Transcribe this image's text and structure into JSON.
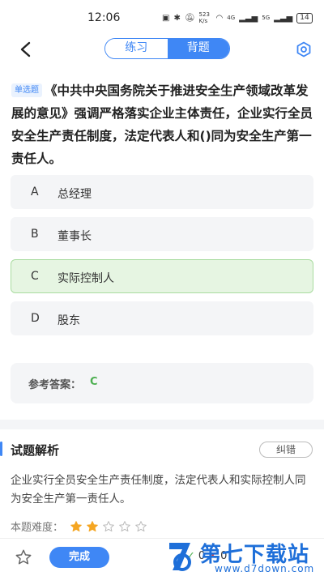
{
  "status_bar": {
    "time": "12:06",
    "network_speed": "523 K/s",
    "signal_labels": [
      "4G",
      "5G"
    ],
    "battery": "14"
  },
  "header": {
    "tabs": [
      {
        "label": "练习",
        "active": false
      },
      {
        "label": "背题",
        "active": true
      }
    ]
  },
  "question": {
    "type_badge": "单选题",
    "text": "《中共中央国务院关于推进安全生产领域改革发展的意见》强调严格落实企业主体责任，企业实行全员安全生产责任制度，法定代表人和()同为安全生产第一责任人。"
  },
  "options": [
    {
      "letter": "A",
      "text": "总经理",
      "state": "normal"
    },
    {
      "letter": "B",
      "text": "董事长",
      "state": "normal"
    },
    {
      "letter": "C",
      "text": "实际控制人",
      "state": "correct"
    },
    {
      "letter": "D",
      "text": "股东",
      "state": "normal"
    }
  ],
  "reference_answer": {
    "label": "参考答案：",
    "value": "C"
  },
  "analysis": {
    "title": "试题解析",
    "report_label": "纠错",
    "text": "企业实行全员安全生产责任制度，法定代表人和实际控制人同为安全生产第一责任人。",
    "difficulty_label": "本题难度：",
    "difficulty_stars": 2,
    "difficulty_max": 5
  },
  "bottom_bar": {
    "done_label": "完成",
    "correct_count": "0",
    "wrong_count": "0"
  },
  "watermark": {
    "text": "第七下载站",
    "url": "www.d7down.com"
  },
  "colors": {
    "accent": "#3f87f5",
    "correct": "#4caf50",
    "wrong": "#e53935",
    "star": "#f5a623"
  }
}
